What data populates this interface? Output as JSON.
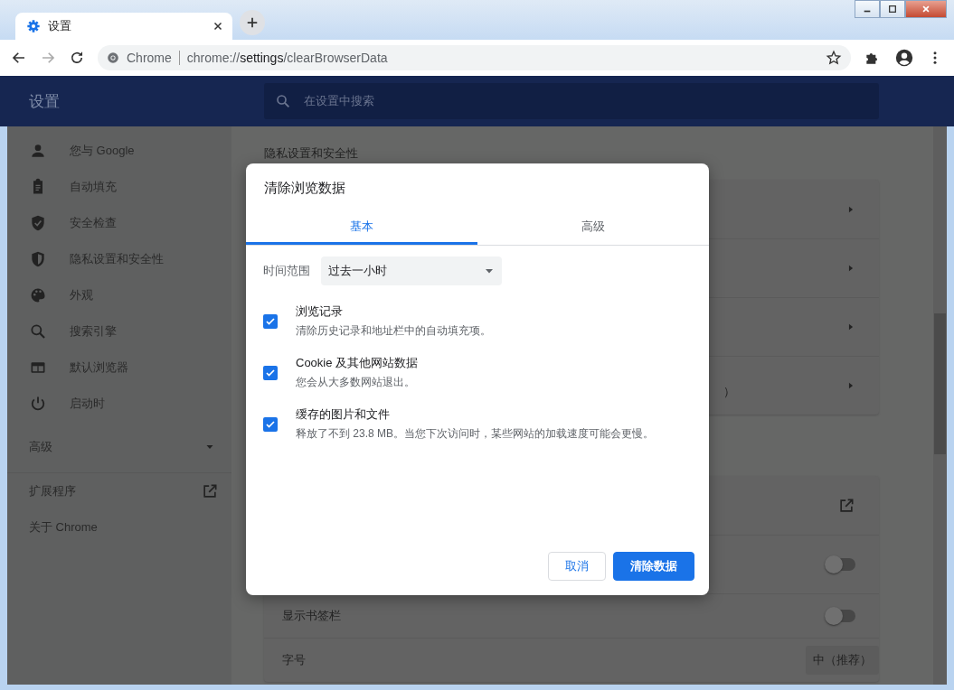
{
  "tab": {
    "title": "设置"
  },
  "toolbar": {
    "site_label": "Chrome",
    "url": "chrome://**settings**/clearBrowserData"
  },
  "header": {
    "title": "设置",
    "search_placeholder": "在设置中搜索"
  },
  "sidebar": {
    "items": [
      {
        "label": "您与 Google",
        "kind": "person"
      },
      {
        "label": "自动填充",
        "kind": "clipboard"
      },
      {
        "label": "安全检查",
        "kind": "shield-check"
      },
      {
        "label": "隐私设置和安全性",
        "kind": "shield-half"
      },
      {
        "label": "外观",
        "kind": "palette"
      },
      {
        "label": "搜索引擎",
        "kind": "search"
      },
      {
        "label": "默认浏览器",
        "kind": "browser"
      },
      {
        "label": "启动时",
        "kind": "power"
      }
    ],
    "advanced": {
      "label": "高级",
      "expanded": false
    },
    "links": [
      {
        "label": "扩展程序",
        "external": true
      },
      {
        "label": "关于 Chrome",
        "external": false
      }
    ]
  },
  "content": {
    "section_title": "隐私设置和安全性",
    "card_1": [
      {
        "kind": "arrow"
      },
      {
        "kind": "arrow"
      },
      {
        "kind": "arrow"
      },
      {
        "kind": "arrow",
        "text": "）"
      }
    ],
    "card_2": [
      {
        "kind": "external"
      },
      {
        "kind": "toggle",
        "on": false
      },
      {
        "kind": "toggle",
        "label": "显示书签栏",
        "on": false
      },
      {
        "kind": "select",
        "label": "字号",
        "value": "中（推荐）"
      }
    ]
  },
  "dialog": {
    "title": "清除浏览数据",
    "tabs": [
      {
        "label": "基本",
        "selected": true
      },
      {
        "label": "高级",
        "selected": false
      }
    ],
    "time_range": {
      "label": "时间范围",
      "value": "过去一小时"
    },
    "options": [
      {
        "title": "浏览记录",
        "description": "清除历史记录和地址栏中的自动填充项。",
        "checked": true
      },
      {
        "title": "Cookie 及其他网站数据",
        "description": "您会从大多数网站退出。",
        "checked": true
      },
      {
        "title": "缓存的图片和文件",
        "description": "释放了不到 23.8 MB。当您下次访问时，某些网站的加载速度可能会更慢。",
        "checked": true
      }
    ],
    "buttons": [
      {
        "label": "取消",
        "kind": "secondary"
      },
      {
        "label": "清除数据",
        "kind": "primary"
      }
    ]
  }
}
